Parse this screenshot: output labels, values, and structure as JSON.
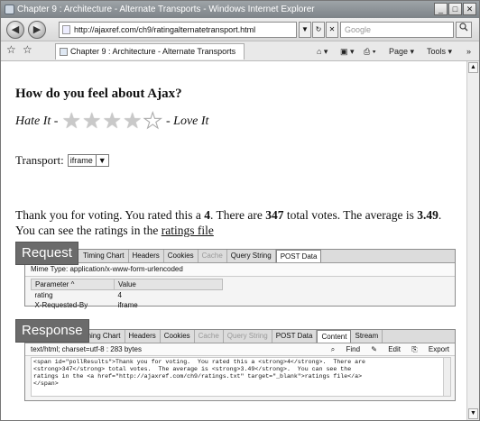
{
  "window": {
    "title": "Chapter 9 : Architecture - Alternate Transports - Windows Internet Explorer",
    "buttons": [
      "_",
      "□",
      "✕"
    ]
  },
  "nav": {
    "back": "◀",
    "forward": "▶",
    "url": "http://ajaxref.com/ch9/ratingalternatetransport.html",
    "url_dropdown": "▼",
    "refresh": "↻",
    "stop": "✕",
    "search_placeholder": "Google"
  },
  "tabs": {
    "fav_star": "☆",
    "add_fav": "☆",
    "active_tab": "Chapter 9 : Architecture - Alternate Transports",
    "commands": {
      "home": "⌂ ▾",
      "feeds": "▣ ▾",
      "print": "⎙ ▾",
      "page": "Page ▾",
      "tools": "Tools ▾",
      "more": "»"
    }
  },
  "page": {
    "question": "How do you feel about Ajax?",
    "hate": "Hate It -",
    "love": "- Love It",
    "stars": {
      "filled": 4,
      "total": 5
    },
    "transport_label": "Transport:",
    "transport_value": "iframe",
    "thanks": {
      "p1": "Thank you for voting. You rated this a ",
      "rating": "4",
      "p2": ". There are ",
      "votes": "347",
      "p3": " total votes. The average is ",
      "average": "3.49",
      "p4": ". You can see the ratings in the ",
      "link": "ratings file"
    }
  },
  "request_panel": {
    "label": "Request",
    "tabs": [
      "Timing Chart",
      "Headers",
      "Cookies",
      "Cache",
      "Query String",
      "POST Data"
    ],
    "mime_label": "Mime Type:",
    "mime_value": "application/x-www-form-urlencoded",
    "columns": [
      "Parameter ^",
      "Value"
    ],
    "rows": [
      [
        "rating",
        "4"
      ],
      [
        "X-Requested-By",
        "iframe"
      ]
    ]
  },
  "response_panel": {
    "label": "Response",
    "tabs": [
      "Timing Chart",
      "Headers",
      "Cookies",
      "Cache",
      "Query String",
      "POST Data",
      "Content",
      "Stream"
    ],
    "info": "text/html; charset=utf-8 : 283 bytes",
    "find": "Find",
    "edit": "Edit",
    "export": "Export",
    "code": "<span id=\"pollResults\">Thank you for voting.  You rated this a <strong>4</strong>.  There are\n<strong>347</strong> total votes.  The average is <strong>3.49</strong>.  You can see the\nratings in the <a href=\"http://ajaxref.com/ch9/ratings.txt\" target=\"_blank\">ratings file</a>\n</span>"
  }
}
